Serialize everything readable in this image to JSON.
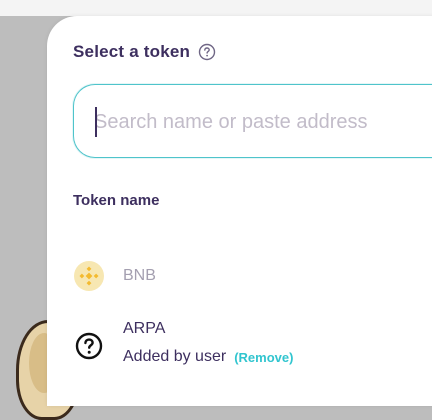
{
  "modal": {
    "title": "Select a token",
    "help_icon": "question-circle-icon"
  },
  "search": {
    "placeholder": "Search name or paste address",
    "value": "",
    "border_color": "#4fc4cb"
  },
  "list": {
    "section_label": "Token name",
    "tokens": [
      {
        "symbol": "BNB",
        "icon": "bnb-icon",
        "disabled": true
      },
      {
        "symbol": "ARPA",
        "icon": "unknown-token-icon",
        "note": "Added by user",
        "action_label": "(Remove)"
      }
    ]
  },
  "colors": {
    "primary_text": "#3d2f5f",
    "muted_text": "#a49fb0",
    "accent": "#31c5cf",
    "bnb_yellow": "#f3ba2f"
  }
}
